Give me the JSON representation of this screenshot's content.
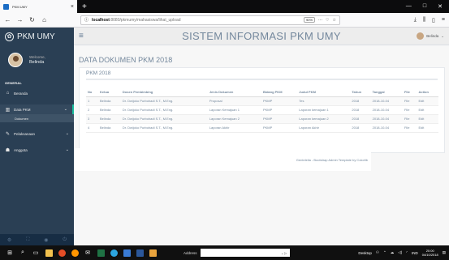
{
  "browser": {
    "tab_title": "PKM UMY",
    "new_tab": "+",
    "url_host": "localhost",
    "url_path": ":8080/pkmumy/mahasiswa/lihat_upload",
    "zoom": "90%",
    "win_min": "—",
    "win_max": "□",
    "win_close": "✕"
  },
  "sidebar": {
    "brand": "PKM UMY",
    "welcome": "Welcome,",
    "user_name": "Belinda",
    "section_label": "GENERAL",
    "items": [
      {
        "label": "Beranda",
        "icon": "home-icon"
      },
      {
        "label": "Data PKM",
        "icon": "chart-icon"
      },
      {
        "label": "Dokumen",
        "icon": ""
      },
      {
        "label": "Pelaksanaan",
        "icon": "edit-icon"
      },
      {
        "label": "Anggota",
        "icon": "users-icon"
      }
    ]
  },
  "header": {
    "app_title": "SISTEM INFORMASI PKM UMY",
    "user_name": "Belinda"
  },
  "main": {
    "page_title": "DATA DOKUMEN PKM 2018",
    "panel_title": "PKM 2018",
    "table": {
      "headers": [
        "No",
        "Ketua",
        "Dosen Pembimbing",
        "Jenis Dokumen",
        "Bidang PKM",
        "Judul PKM",
        "Tahun",
        "Tanggal",
        "File",
        "Action"
      ],
      "rows": [
        [
          "1",
          "Belinda",
          "Dr. Dwijoko Purbohadi S.T., M.Eng.",
          "Proposal",
          "PKMP",
          "Tes",
          "2018",
          "2018-10-04",
          "File",
          "Edit"
        ],
        [
          "2",
          "Belinda",
          "Dr. Dwijoko Purbohadi S.T., M.Eng.",
          "Laporan Kemajuan 1",
          "PKMP",
          "Laporan kemajuan 1",
          "2018",
          "2018-10-04",
          "File",
          "Edit"
        ],
        [
          "3",
          "Belinda",
          "Dr. Dwijoko Purbohadi S.T., M.Eng.",
          "Laporan Kemajuan 2",
          "PKMP",
          "Laporan kemajuan 2",
          "2018",
          "2018-10-04",
          "File",
          "Edit"
        ],
        [
          "4",
          "Belinda",
          "Dr. Dwijoko Purbohadi S.T., M.Eng.",
          "Laporan Akhir",
          "PKMP",
          "Laporan Akhir",
          "2018",
          "2018-10-04",
          "File",
          "Edit"
        ]
      ]
    },
    "footer": "Gentelella - Bootstrap Admin Template by Colorlib"
  },
  "taskbar": {
    "address_label": "Address",
    "desktop_label": "Desktop",
    "lang": "IND",
    "time": "20:00",
    "date": "04/10/2018"
  },
  "colors": {
    "sidebar": "#2a3f54",
    "accent": "#1abb9c",
    "text": "#73879c"
  }
}
